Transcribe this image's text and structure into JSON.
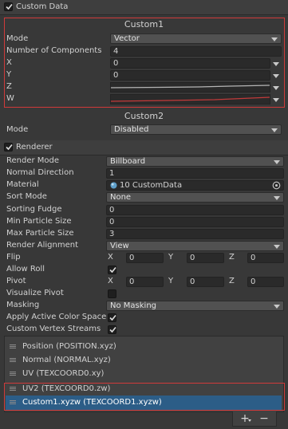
{
  "custom_data": {
    "header": "Custom Data",
    "enabled": true,
    "custom1": {
      "title": "Custom1",
      "mode_label": "Mode",
      "mode_value": "Vector",
      "num_components_label": "Number of Components",
      "num_components_value": "4",
      "x_label": "X",
      "x_value": "0",
      "y_label": "Y",
      "y_value": "0",
      "z_label": "Z",
      "w_label": "W"
    },
    "custom2": {
      "title": "Custom2",
      "mode_label": "Mode",
      "mode_value": "Disabled"
    }
  },
  "renderer": {
    "header": "Renderer",
    "enabled": true,
    "render_mode": {
      "label": "Render Mode",
      "value": "Billboard"
    },
    "normal_direction": {
      "label": "Normal Direction",
      "value": "1"
    },
    "material": {
      "label": "Material",
      "value": "10 CustomData"
    },
    "sort_mode": {
      "label": "Sort Mode",
      "value": "None"
    },
    "sorting_fudge": {
      "label": "Sorting Fudge",
      "value": "0"
    },
    "min_particle_size": {
      "label": "Min Particle Size",
      "value": "0"
    },
    "max_particle_size": {
      "label": "Max Particle Size",
      "value": "3"
    },
    "render_alignment": {
      "label": "Render Alignment",
      "value": "View"
    },
    "flip": {
      "label": "Flip",
      "x_label": "X",
      "x": "0",
      "y_label": "Y",
      "y": "0",
      "z_label": "Z",
      "z": "0"
    },
    "allow_roll": {
      "label": "Allow Roll",
      "checked": true
    },
    "pivot": {
      "label": "Pivot",
      "x_label": "X",
      "x": "0",
      "y_label": "Y",
      "y": "0",
      "z_label": "Z",
      "z": "0"
    },
    "visualize_pivot": {
      "label": "Visualize Pivot",
      "checked": false
    },
    "masking": {
      "label": "Masking",
      "value": "No Masking"
    },
    "apply_active_color_space": {
      "label": "Apply Active Color Space",
      "checked": true
    },
    "custom_vertex_streams": {
      "label": "Custom Vertex Streams",
      "checked": true
    },
    "streams": [
      "Position (POSITION.xyz)",
      "Normal (NORMAL.xyz)",
      "UV (TEXCOORD0.xy)",
      "UV2 (TEXCOORD0.zw)",
      "Custom1.xyzw (TEXCOORD1.xyzw)"
    ],
    "add_label": "+",
    "remove_label": "−"
  },
  "colors": {
    "highlight_box": "#d03a3a",
    "selected_row": "#2c5d87"
  }
}
